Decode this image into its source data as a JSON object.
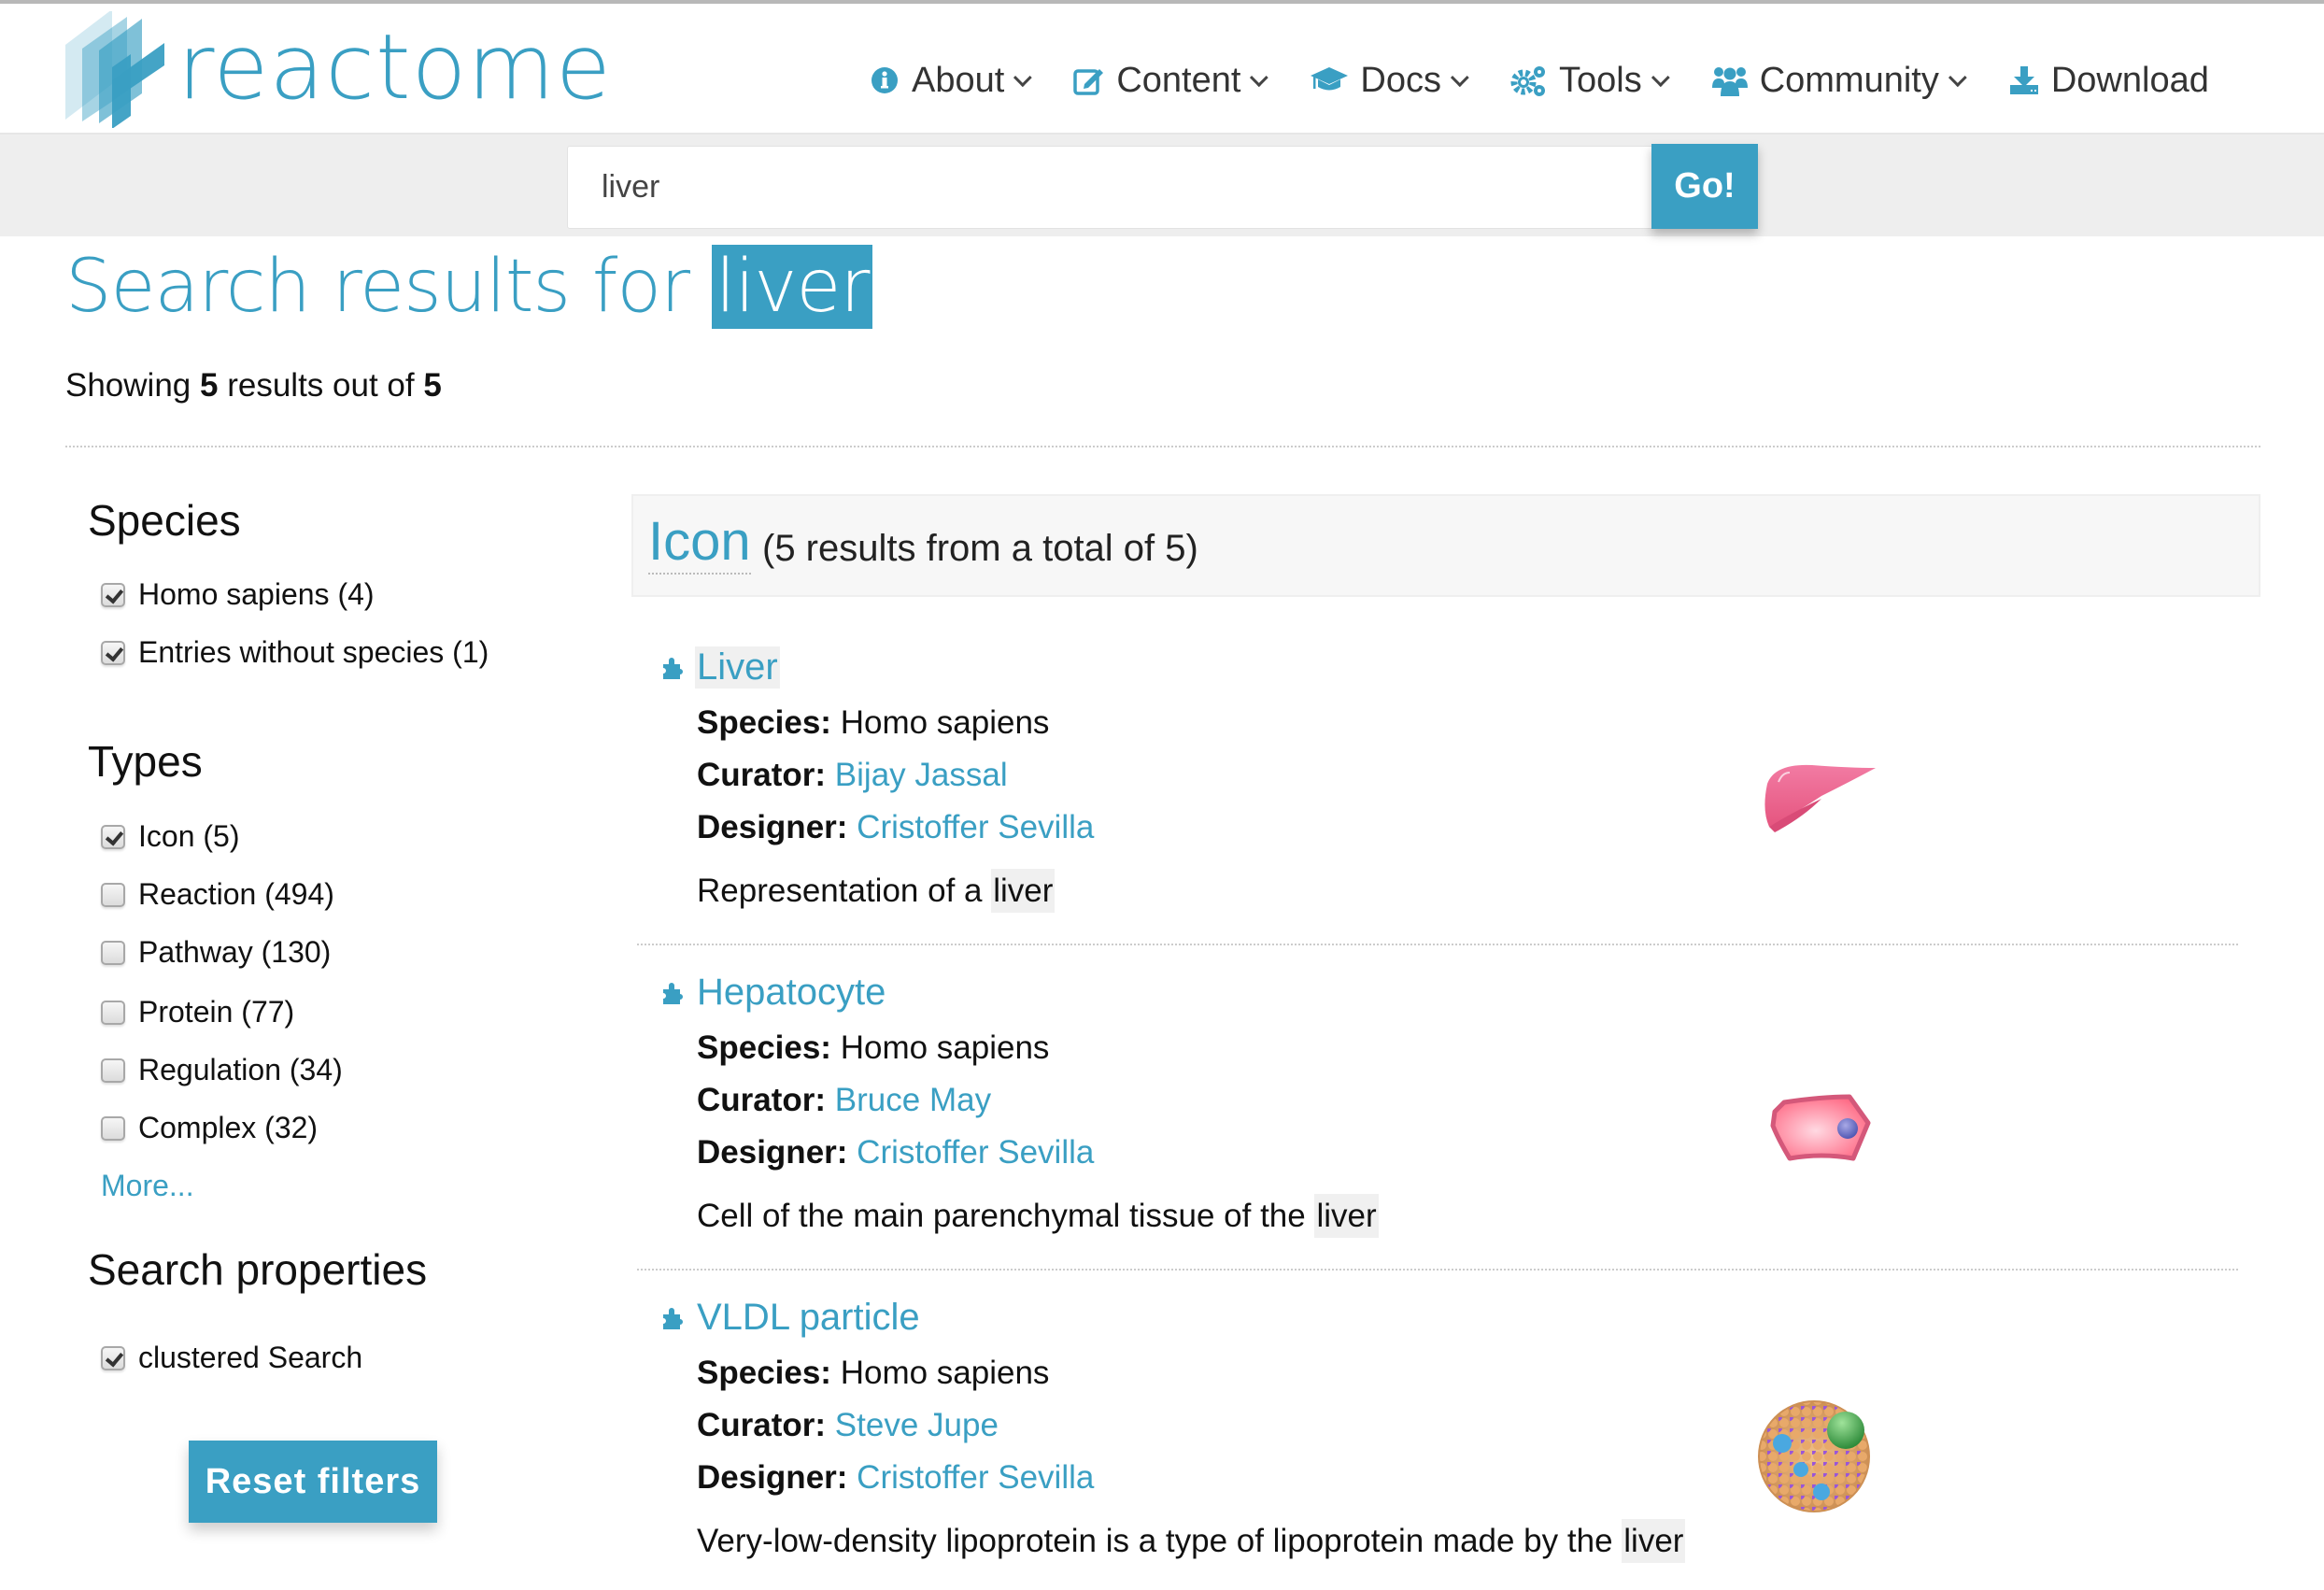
{
  "header": {
    "logo_text": "reactome",
    "nav": [
      {
        "label": "About",
        "icon": "info-circle-icon",
        "has_dropdown": true
      },
      {
        "label": "Content",
        "icon": "edit-icon",
        "has_dropdown": true
      },
      {
        "label": "Docs",
        "icon": "graduation-cap-icon",
        "has_dropdown": true
      },
      {
        "label": "Tools",
        "icon": "cogs-icon",
        "has_dropdown": true
      },
      {
        "label": "Community",
        "icon": "users-icon",
        "has_dropdown": true
      },
      {
        "label": "Download",
        "icon": "download-icon",
        "has_dropdown": false
      }
    ]
  },
  "search": {
    "value": "liver",
    "button_label": "Go!"
  },
  "page": {
    "title_prefix": "Search results for",
    "title_query": "liver",
    "showing_prefix": "Showing",
    "showing_count": "5",
    "showing_middle": "results out of",
    "showing_total": "5"
  },
  "sidebar": {
    "species_heading": "Species",
    "species": [
      {
        "label": "Homo sapiens (4)",
        "checked": true
      },
      {
        "label": "Entries without species (1)",
        "checked": true
      }
    ],
    "types_heading": "Types",
    "types": [
      {
        "label": "Icon (5)",
        "checked": true
      },
      {
        "label": "Reaction (494)",
        "checked": false
      },
      {
        "label": "Pathway (130)",
        "checked": false
      },
      {
        "label": "Protein (77)",
        "checked": false
      },
      {
        "label": "Regulation (34)",
        "checked": false
      },
      {
        "label": "Complex (32)",
        "checked": false
      }
    ],
    "more_label": "More...",
    "properties_heading": "Search properties",
    "properties": [
      {
        "label": "clustered Search",
        "checked": true
      }
    ],
    "reset_label": "Reset filters"
  },
  "results": {
    "group_type": "Icon",
    "group_count": "(5 results from a total of 5)",
    "species_label": "Species:",
    "curator_label": "Curator:",
    "designer_label": "Designer:",
    "items": [
      {
        "name": "Liver",
        "species": "Homo sapiens",
        "curator": "Bijay Jassal",
        "designer": "Cristoffer Sevilla",
        "description": "Representation of a",
        "description_highlight": "liver",
        "image": "liver-icon-image"
      },
      {
        "name": "Hepatocyte",
        "species": "Homo sapiens",
        "curator": "Bruce May",
        "designer": "Cristoffer Sevilla",
        "description": "Cell of the main parenchymal tissue of the",
        "description_highlight": "liver",
        "image": "hepatocyte-icon-image"
      },
      {
        "name": "VLDL particle",
        "species": "Homo sapiens",
        "curator": "Steve Jupe",
        "designer": "Cristoffer Sevilla",
        "description": "Very-low-density lipoprotein is a type of lipoprotein made by the",
        "description_highlight": "liver",
        "image": "vldl-particle-icon-image"
      }
    ]
  },
  "colors": {
    "brand": "#3a9fc3",
    "search_band": "#eeeeee",
    "highlight": "#f0f0f0"
  }
}
